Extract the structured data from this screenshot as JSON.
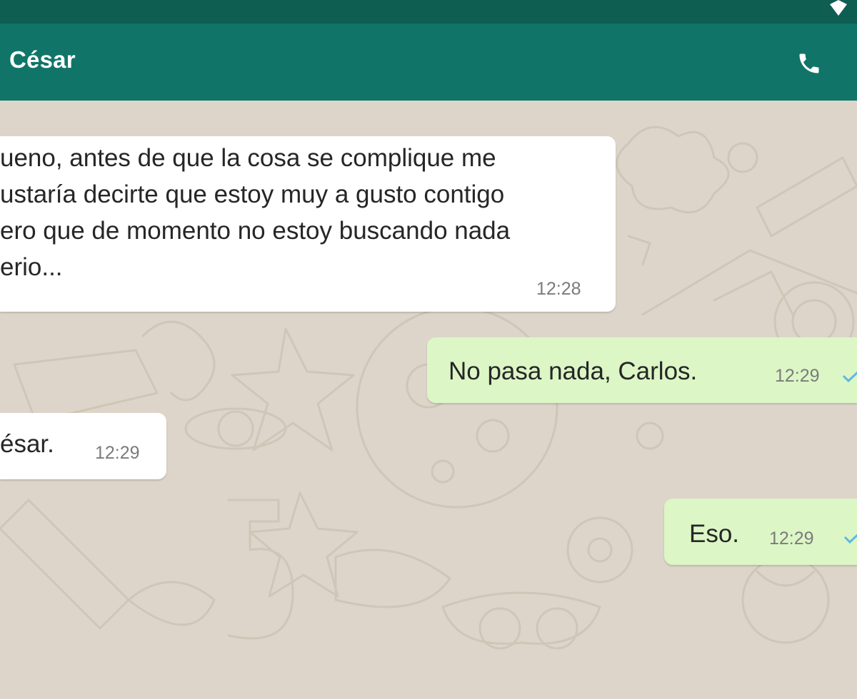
{
  "header": {
    "contact_name": "César",
    "call_icon": "phone-icon"
  },
  "colors": {
    "status_bar": "#0e5e52",
    "header": "#107568",
    "incoming_bubble": "#ffffff",
    "outgoing_bubble": "#dcf6c6",
    "chat_background": "#ddd5c9",
    "read_receipt": "#5fb7e0"
  },
  "messages": [
    {
      "direction": "incoming",
      "lines": [
        "ueno, antes de que la cosa se complique me",
        "ustaría decirte que estoy muy a gusto contigo",
        "ero que de momento no estoy buscando nada",
        "erio..."
      ],
      "time": "12:28"
    },
    {
      "direction": "outgoing",
      "text": "No pasa nada, Carlos.",
      "time": "12:29",
      "status_icon": "check-icon"
    },
    {
      "direction": "incoming",
      "text": "ésar.",
      "time": "12:29"
    },
    {
      "direction": "outgoing",
      "text": "Eso.",
      "time": "12:29",
      "status_icon": "check-icon"
    }
  ]
}
